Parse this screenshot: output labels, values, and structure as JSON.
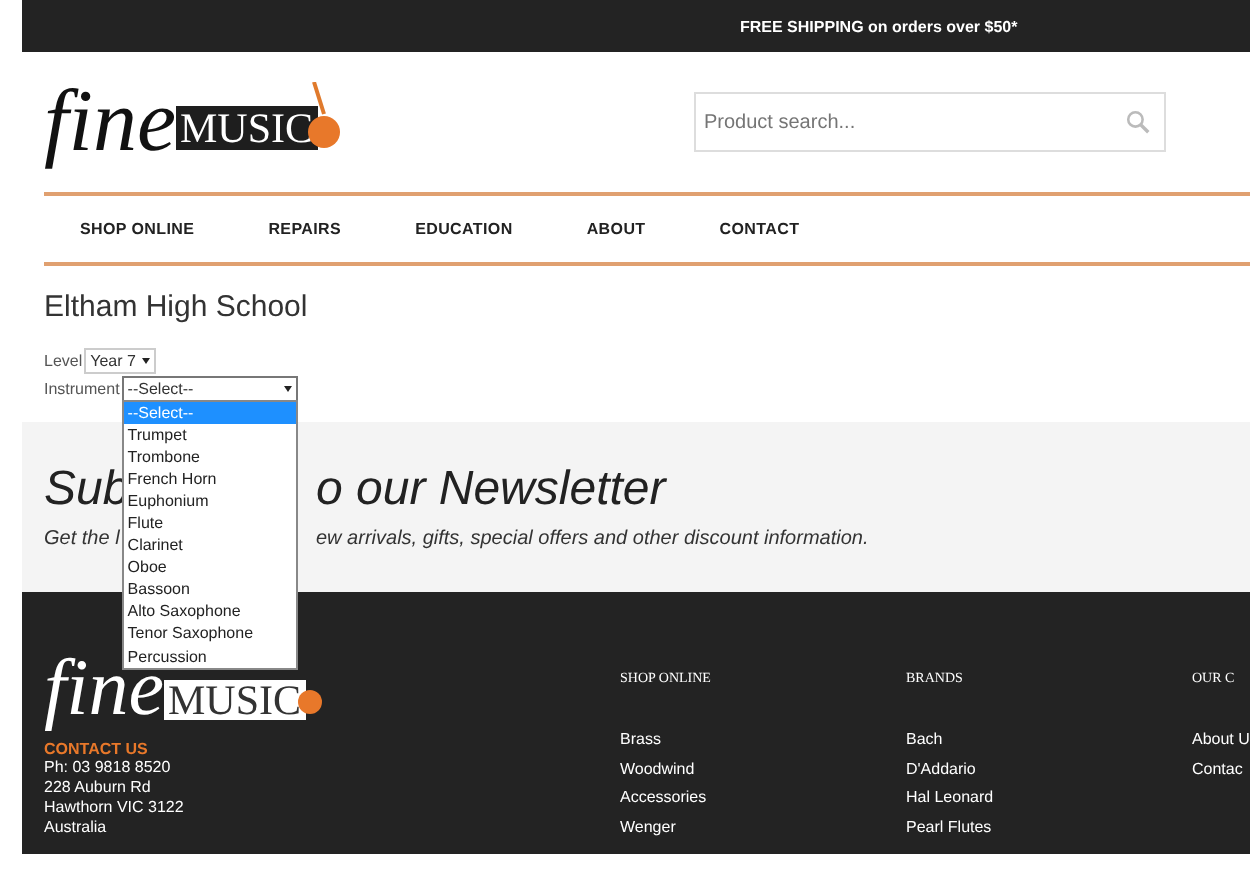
{
  "top_bar": {
    "promo": "FREE SHIPPING on orders over $50*"
  },
  "header": {
    "logo": {
      "script": "fine",
      "wordmark": "MUSIC"
    },
    "search": {
      "placeholder": "Product search..."
    }
  },
  "nav": [
    {
      "label": "SHOP ONLINE"
    },
    {
      "label": "REPAIRS"
    },
    {
      "label": "EDUCATION"
    },
    {
      "label": "ABOUT"
    },
    {
      "label": "CONTACT"
    }
  ],
  "page": {
    "title": "Eltham High School",
    "fields": [
      {
        "label": "Level",
        "value": "Year 7",
        "expanded": false
      },
      {
        "label": "Instrument",
        "value": "--Select--",
        "expanded": true,
        "options": [
          {
            "label": "--Select--",
            "selected": true
          },
          {
            "label": "Trumpet",
            "selected": false
          },
          {
            "label": "Trombone",
            "selected": false
          },
          {
            "label": "French Horn",
            "selected": false
          },
          {
            "label": "Euphonium",
            "selected": false
          },
          {
            "label": "Flute",
            "selected": false
          },
          {
            "label": "Clarinet",
            "selected": false
          },
          {
            "label": "Oboe",
            "selected": false
          },
          {
            "label": "Bassoon",
            "selected": false
          },
          {
            "label": "Alto Saxophone",
            "selected": false
          },
          {
            "label": "Tenor Saxophone",
            "selected": false
          },
          {
            "label": "Percussion",
            "selected": false
          }
        ]
      }
    ]
  },
  "newsletter": {
    "heading_parts": [
      "Sub",
      "o our Newsletter"
    ],
    "subtitle_parts": [
      "Get the l",
      "ew arrivals, gifts, special offers and other discount information."
    ]
  },
  "footer": {
    "logo": {
      "script": "fine",
      "wordmark": "MUSIC"
    },
    "contact": {
      "heading": "CONTACT US",
      "lines": [
        "Ph: 03 9818 8520",
        "228 Auburn Rd",
        "Hawthorn VIC 3122",
        "Australia"
      ]
    },
    "columns": [
      {
        "heading": "SHOP ONLINE",
        "links": [
          "Brass",
          "Woodwind",
          "Accessories",
          "Wenger"
        ]
      },
      {
        "heading": "BRANDS",
        "links": [
          "Bach",
          "D'Addario",
          "Hal Leonard",
          "Pearl Flutes"
        ]
      },
      {
        "heading": "OUR C",
        "links": [
          "About U",
          "Contac"
        ]
      }
    ]
  }
}
